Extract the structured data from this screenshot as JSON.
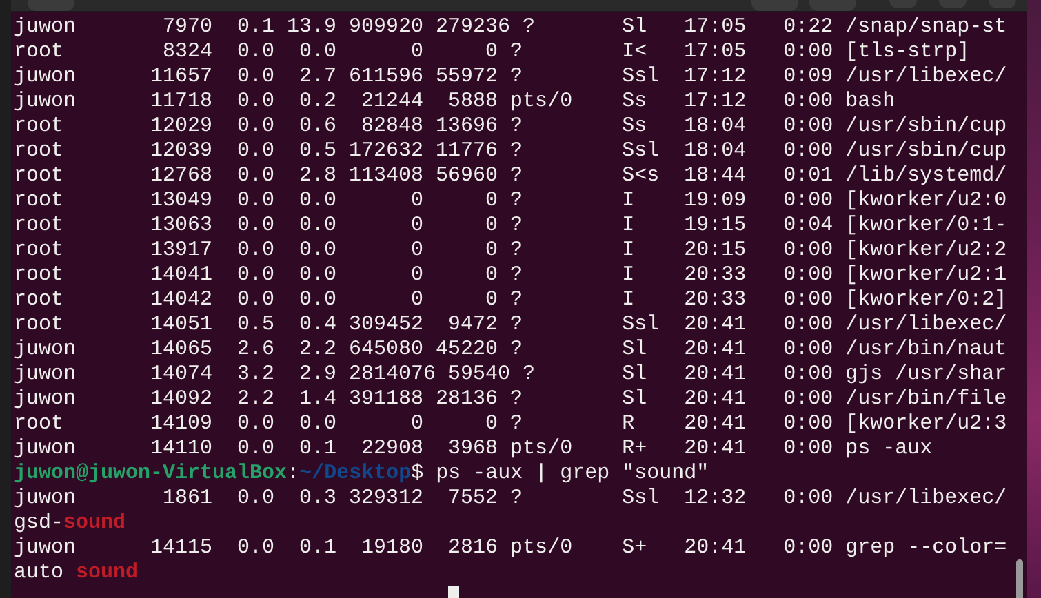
{
  "terminal": {
    "lines": [
      {
        "kind": "process",
        "user": "juwon",
        "pid": "7970",
        "cpu": "0.1",
        "mem": "13.9",
        "vsz": "909920",
        "rss": "279236",
        "tty": "?",
        "stat": "Sl",
        "start": "17:05",
        "time": "0:22",
        "command": "/snap/snap-st"
      },
      {
        "kind": "process",
        "user": "root",
        "pid": "8324",
        "cpu": "0.0",
        "mem": "0.0",
        "vsz": "0",
        "rss": "0",
        "tty": "?",
        "stat": "I<",
        "start": "17:05",
        "time": "0:00",
        "command": "[tls-strp]"
      },
      {
        "kind": "process",
        "user": "juwon",
        "pid": "11657",
        "cpu": "0.0",
        "mem": "2.7",
        "vsz": "611596",
        "rss": "55972",
        "tty": "?",
        "stat": "Ssl",
        "start": "17:12",
        "time": "0:09",
        "command": "/usr/libexec/"
      },
      {
        "kind": "process",
        "user": "juwon",
        "pid": "11718",
        "cpu": "0.0",
        "mem": "0.2",
        "vsz": "21244",
        "rss": "5888",
        "tty": "pts/0",
        "stat": "Ss",
        "start": "17:12",
        "time": "0:00",
        "command": "bash"
      },
      {
        "kind": "process",
        "user": "root",
        "pid": "12029",
        "cpu": "0.0",
        "mem": "0.6",
        "vsz": "82848",
        "rss": "13696",
        "tty": "?",
        "stat": "Ss",
        "start": "18:04",
        "time": "0:00",
        "command": "/usr/sbin/cup"
      },
      {
        "kind": "process",
        "user": "root",
        "pid": "12039",
        "cpu": "0.0",
        "mem": "0.5",
        "vsz": "172632",
        "rss": "11776",
        "tty": "?",
        "stat": "Ssl",
        "start": "18:04",
        "time": "0:00",
        "command": "/usr/sbin/cup"
      },
      {
        "kind": "process",
        "user": "root",
        "pid": "12768",
        "cpu": "0.0",
        "mem": "2.8",
        "vsz": "113408",
        "rss": "56960",
        "tty": "?",
        "stat": "S<s",
        "start": "18:44",
        "time": "0:01",
        "command": "/lib/systemd/"
      },
      {
        "kind": "process",
        "user": "root",
        "pid": "13049",
        "cpu": "0.0",
        "mem": "0.0",
        "vsz": "0",
        "rss": "0",
        "tty": "?",
        "stat": "I",
        "start": "19:09",
        "time": "0:00",
        "command": "[kworker/u2:0"
      },
      {
        "kind": "process",
        "user": "root",
        "pid": "13063",
        "cpu": "0.0",
        "mem": "0.0",
        "vsz": "0",
        "rss": "0",
        "tty": "?",
        "stat": "I",
        "start": "19:15",
        "time": "0:04",
        "command": "[kworker/0:1-"
      },
      {
        "kind": "process",
        "user": "root",
        "pid": "13917",
        "cpu": "0.0",
        "mem": "0.0",
        "vsz": "0",
        "rss": "0",
        "tty": "?",
        "stat": "I",
        "start": "20:15",
        "time": "0:00",
        "command": "[kworker/u2:2"
      },
      {
        "kind": "process",
        "user": "root",
        "pid": "14041",
        "cpu": "0.0",
        "mem": "0.0",
        "vsz": "0",
        "rss": "0",
        "tty": "?",
        "stat": "I",
        "start": "20:33",
        "time": "0:00",
        "command": "[kworker/u2:1"
      },
      {
        "kind": "process",
        "user": "root",
        "pid": "14042",
        "cpu": "0.0",
        "mem": "0.0",
        "vsz": "0",
        "rss": "0",
        "tty": "?",
        "stat": "I",
        "start": "20:33",
        "time": "0:00",
        "command": "[kworker/0:2]"
      },
      {
        "kind": "process",
        "user": "root",
        "pid": "14051",
        "cpu": "0.5",
        "mem": "0.4",
        "vsz": "309452",
        "rss": "9472",
        "tty": "?",
        "stat": "Ssl",
        "start": "20:41",
        "time": "0:00",
        "command": "/usr/libexec/"
      },
      {
        "kind": "process",
        "user": "juwon",
        "pid": "14065",
        "cpu": "2.6",
        "mem": "2.2",
        "vsz": "645080",
        "rss": "45220",
        "tty": "?",
        "stat": "Sl",
        "start": "20:41",
        "time": "0:00",
        "command": "/usr/bin/naut"
      },
      {
        "kind": "process",
        "user": "juwon",
        "pid": "14074",
        "cpu": "3.2",
        "mem": "2.9",
        "vsz": "2814076",
        "rss": "59540",
        "tty": "?",
        "stat": "Sl",
        "start": "20:41",
        "time": "0:00",
        "command": "gjs /usr/shar"
      },
      {
        "kind": "process",
        "user": "juwon",
        "pid": "14092",
        "cpu": "2.2",
        "mem": "1.4",
        "vsz": "391188",
        "rss": "28136",
        "tty": "?",
        "stat": "Sl",
        "start": "20:41",
        "time": "0:00",
        "command": "/usr/bin/file"
      },
      {
        "kind": "process",
        "user": "root",
        "pid": "14109",
        "cpu": "0.0",
        "mem": "0.0",
        "vsz": "0",
        "rss": "0",
        "tty": "?",
        "stat": "R",
        "start": "20:41",
        "time": "0:00",
        "command": "[kworker/u2:3"
      },
      {
        "kind": "process",
        "user": "juwon",
        "pid": "14110",
        "cpu": "0.0",
        "mem": "0.1",
        "vsz": "22908",
        "rss": "3968",
        "tty": "pts/0",
        "stat": "R+",
        "start": "20:41",
        "time": "0:00",
        "command": "ps -aux"
      },
      {
        "kind": "prompt",
        "segments": [
          {
            "text": "juwon@juwon-VirtualBox",
            "kind": "user"
          },
          {
            "text": ":",
            "kind": "plain"
          },
          {
            "text": "~/Desktop",
            "kind": "path"
          },
          {
            "text": "$ ps -aux | grep \"sound\"",
            "kind": "plain"
          }
        ]
      },
      {
        "kind": "process",
        "user": "juwon",
        "pid": "1861",
        "cpu": "0.0",
        "mem": "0.3",
        "vsz": "329312",
        "rss": "7552",
        "tty": "?",
        "stat": "Ssl",
        "start": "12:32",
        "time": "0:00",
        "command": "/usr/libexec/"
      },
      {
        "kind": "text",
        "segments": [
          {
            "text": "gsd-",
            "kind": "plain"
          },
          {
            "text": "sound",
            "kind": "match"
          }
        ]
      },
      {
        "kind": "process",
        "user": "juwon",
        "pid": "14115",
        "cpu": "0.0",
        "mem": "0.1",
        "vsz": "19180",
        "rss": "2816",
        "tty": "pts/0",
        "stat": "S+",
        "start": "20:41",
        "time": "0:00",
        "command": "grep --color="
      },
      {
        "kind": "text",
        "segments": [
          {
            "text": "auto ",
            "kind": "plain"
          },
          {
            "text": "sound",
            "kind": "match"
          }
        ]
      }
    ]
  }
}
